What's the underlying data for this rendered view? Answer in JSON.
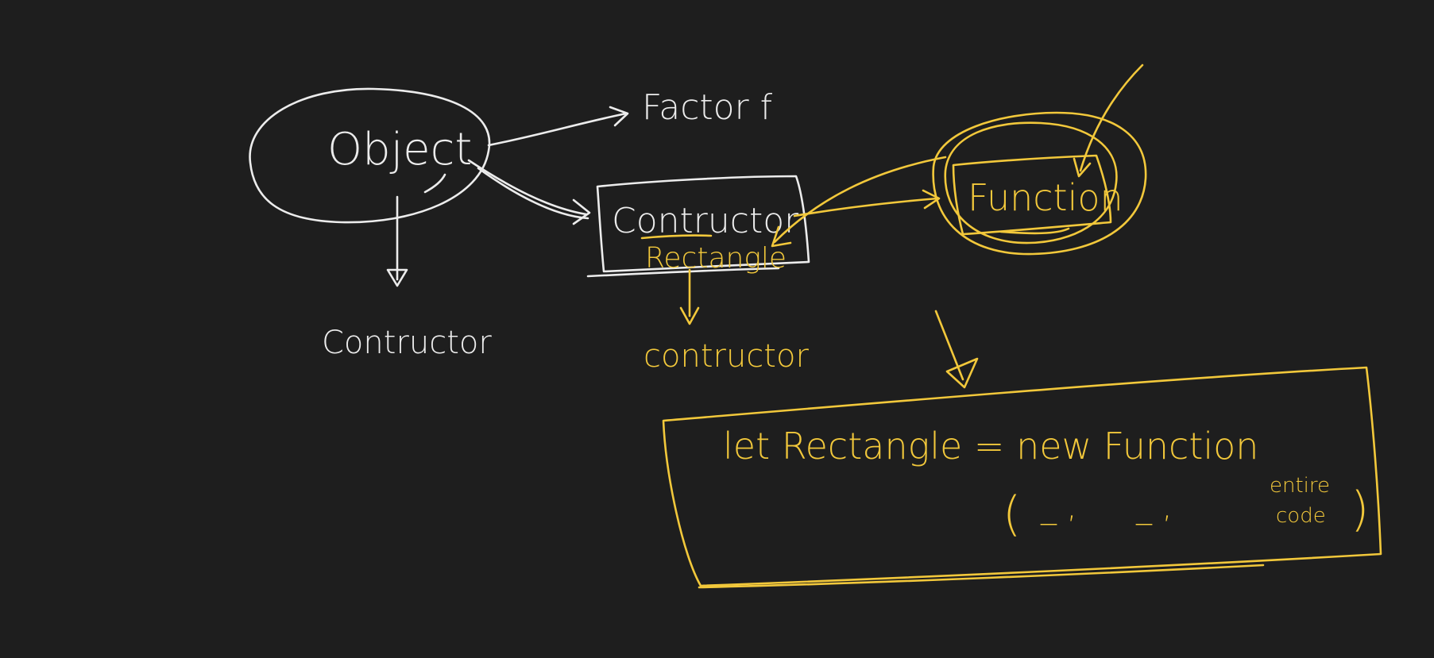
{
  "colors": {
    "background": "#1e1e1e",
    "white_ink": "#ececec",
    "yellow_ink": "#f2c83b"
  },
  "labels": {
    "object": "Object",
    "factory_fn": "Factor f",
    "object_constructor": "Contructor",
    "constructor_box": "Contructor",
    "rectangle": "Rectangle",
    "rectangle_constructor": "contructor",
    "function": "Function"
  },
  "code_box": {
    "line1": "let Rectangle = new Function",
    "paren_open": "(",
    "arg1": "_ ,",
    "arg2": "_ ,",
    "tail_line1": "entire",
    "tail_line2": "code",
    "paren_close": ")"
  }
}
